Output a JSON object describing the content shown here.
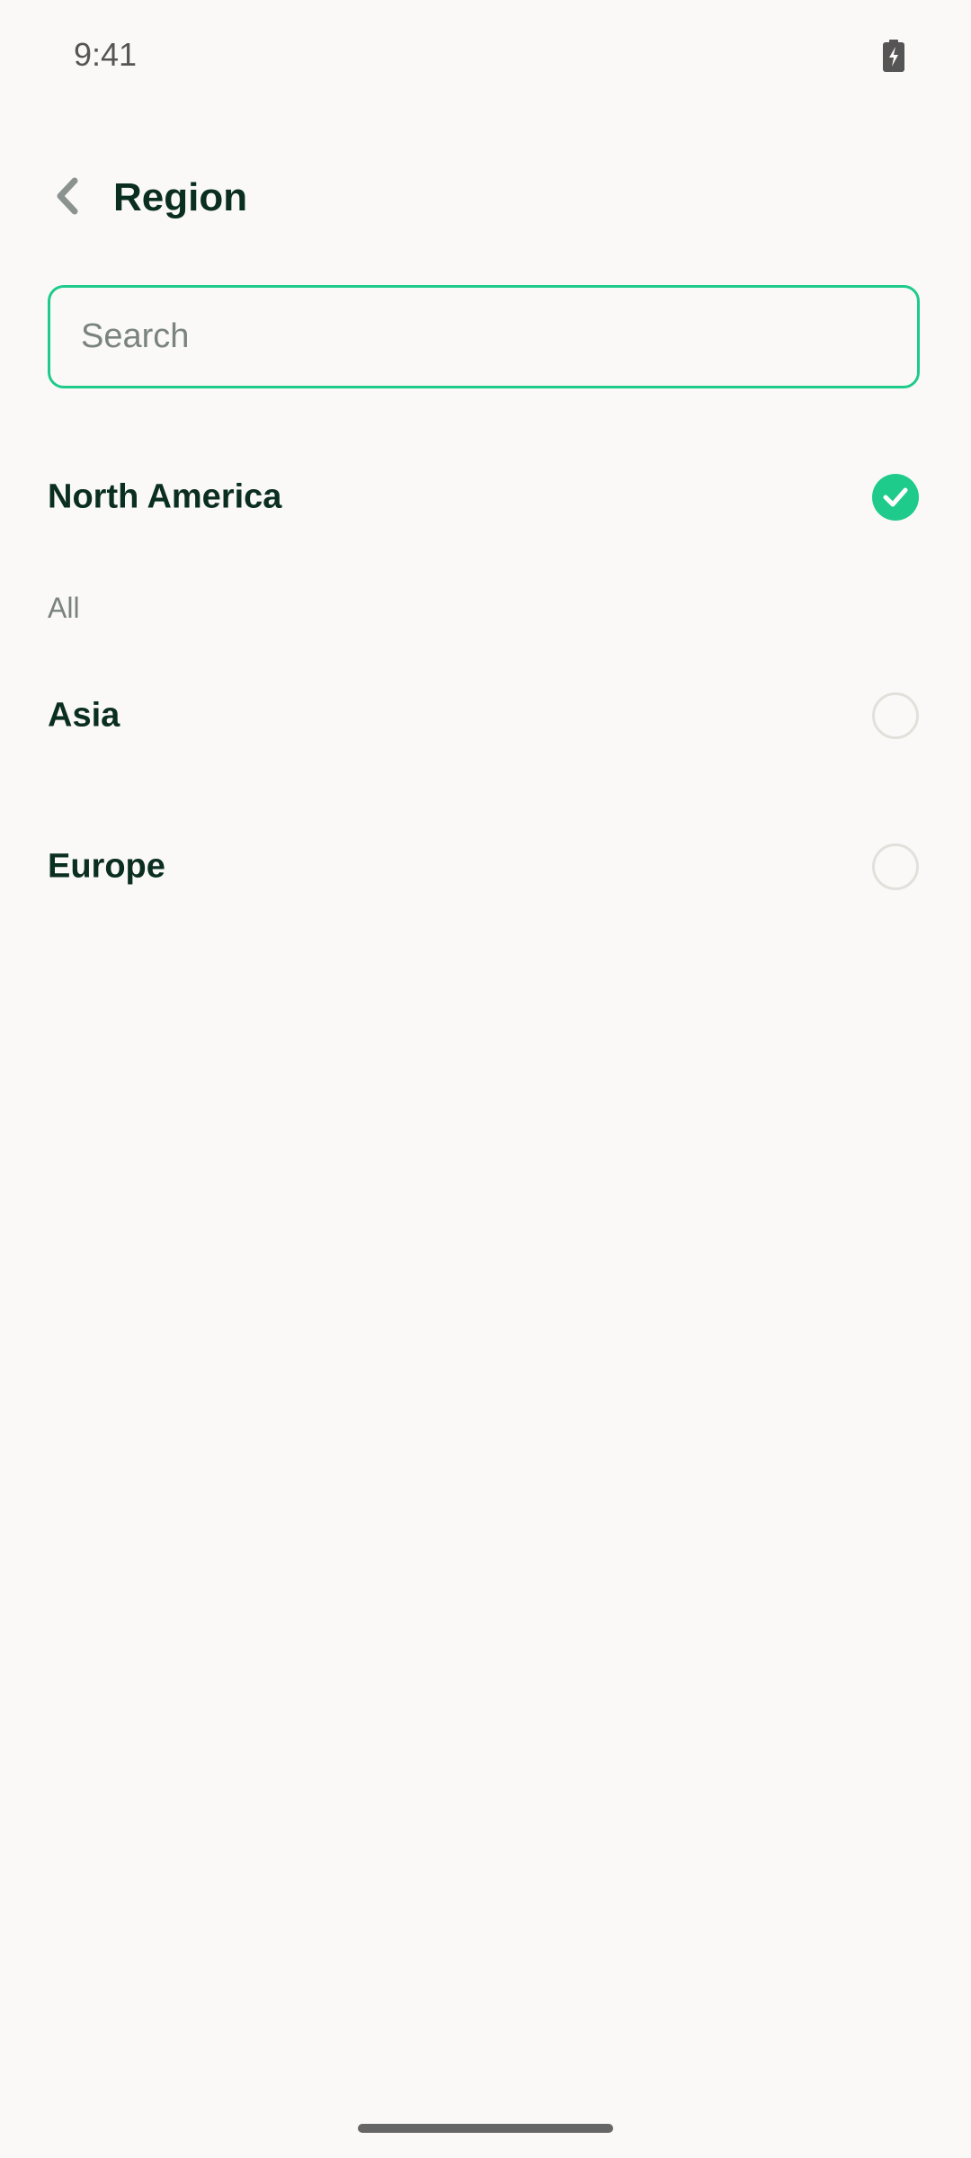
{
  "status_bar": {
    "time": "9:41",
    "battery_icon": "battery-charging-icon"
  },
  "header": {
    "back_icon": "chevron-left-icon",
    "title": "Region"
  },
  "search": {
    "placeholder": "Search",
    "value": ""
  },
  "selected": {
    "label": "North America",
    "checked": true
  },
  "section": {
    "label": "All"
  },
  "options": [
    {
      "label": "Asia",
      "checked": false
    },
    {
      "label": "Europe",
      "checked": false
    }
  ],
  "colors": {
    "accent": "#1FCB8A",
    "text_primary": "#0B2E22",
    "text_secondary": "#7A837F",
    "background": "#FAF9F7",
    "radio_border": "#E3E0DB"
  }
}
